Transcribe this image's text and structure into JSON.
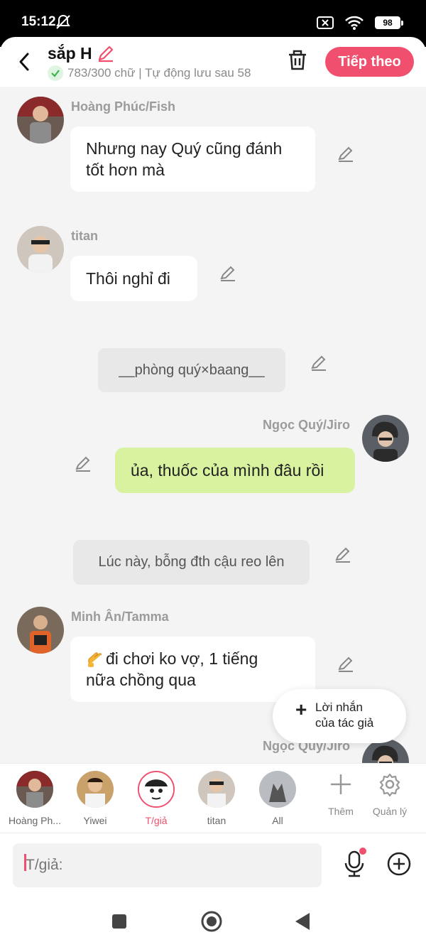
{
  "status": {
    "time": "15:12",
    "battery": "98"
  },
  "header": {
    "title": "sắp H",
    "subtitle": "783/300 chữ | Tự động lưu sau 58",
    "next_label": "Tiếp theo",
    "accent": "#f0506e"
  },
  "messages": [
    {
      "type": "left",
      "name": "Hoàng Phúc/Fish",
      "line1": "Nhưng nay Quý cũng đánh",
      "line2": "tốt hơn mà"
    },
    {
      "type": "left",
      "name": "titan",
      "text": "Thôi nghỉ đi"
    },
    {
      "type": "narration",
      "text": "__phòng quý×baang__"
    },
    {
      "type": "right",
      "name": "Ngọc Quý/Jiro",
      "text": "ủa, thuốc của mình đâu rồi",
      "bubble_color": "#d8f2a0"
    },
    {
      "type": "narration",
      "text": "Lúc này, bỗng đth cậu reo lên"
    },
    {
      "type": "left",
      "name": "Minh Ân/Tamma",
      "line1": "đi chơi ko vợ, 1 tiếng",
      "line2": "nữa chồng qua"
    },
    {
      "type": "right",
      "name": "Ngọc Quý/Jiro"
    }
  ],
  "fab": {
    "line1": "Lời nhắn",
    "line2": "của tác giả"
  },
  "characters": [
    {
      "label": "Hoàng Ph..."
    },
    {
      "label": "Yiwei"
    },
    {
      "label": "T/giả",
      "selected": true
    },
    {
      "label": "titan"
    },
    {
      "label": "All"
    }
  ],
  "tools": {
    "add_label": "Thêm",
    "manage_label": "Quản lý"
  },
  "input": {
    "placeholder": "T/giả:"
  }
}
